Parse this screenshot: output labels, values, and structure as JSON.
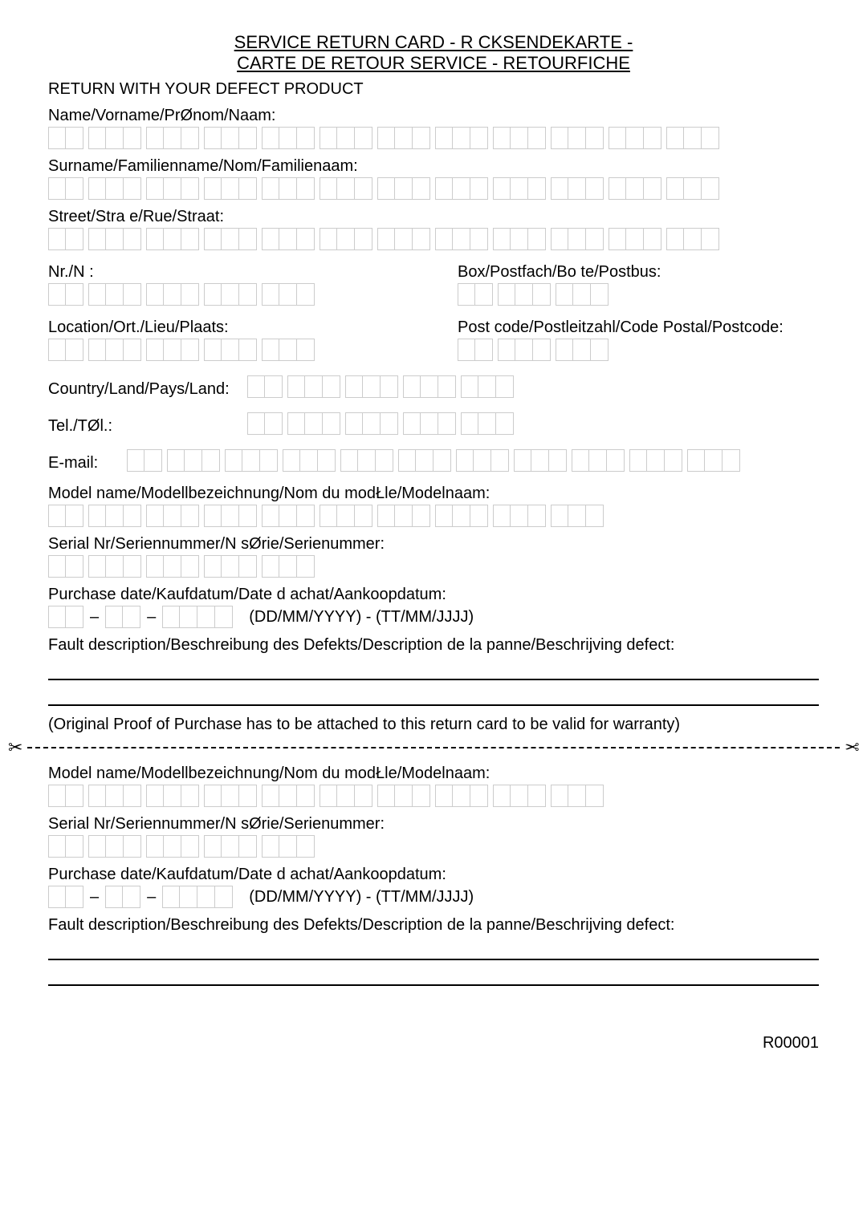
{
  "titles": {
    "line1": "SERVICE RETURN CARD - R CKSENDEKARTE -",
    "line2": "CARTE DE RETOUR SERVICE - RETOURFICHE"
  },
  "instruction": "RETURN WITH YOUR DEFECT PRODUCT",
  "labels": {
    "name": "Name/Vorname/PrØnom/Naam:",
    "surname": "Surname/Familienname/Nom/Familienaam:",
    "street": "Street/Stra e/Rue/Straat:",
    "nr": "Nr./N :",
    "box": "Box/Postfach/Bo te/Postbus:",
    "location": "Location/Ort./Lieu/Plaats:",
    "postcode": "Post code/Postleitzahl/Code Postal/Postcode:",
    "country": "Country/Land/Pays/Land:",
    "tel": "Tel./TØl.:",
    "email": "E-mail:",
    "model": "Model name/Modellbezeichnung/Nom du modŁle/Modelnaam:",
    "serial": "Serial Nr/Seriennummer/N  sØrie/Serienummer:",
    "purchase": "Purchase date/Kaufdatum/Date d achat/Aankoopdatum:",
    "date_hint": "(DD/MM/YYYY) - (TT/MM/JJJJ)",
    "fault": "Fault description/Beschreibung des Defekts/Description de la panne/Beschrijving defect:"
  },
  "warranty": "(Original Proof of Purchase has to be attached to this return card to be valid for warranty)",
  "doc_id": "R00001"
}
